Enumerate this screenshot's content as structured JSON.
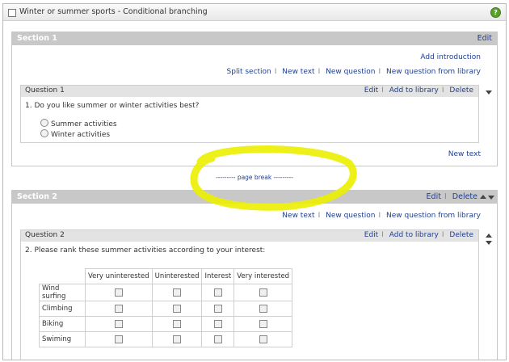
{
  "window": {
    "title": "Winter or summer sports - Conditional branching",
    "help_icon": "?"
  },
  "section1": {
    "title": "Section 1",
    "edit_label": "Edit",
    "add_intro": "Add introduction",
    "links": [
      "Split section",
      "New text",
      "New question",
      "New question from library"
    ],
    "question": {
      "title": "Question 1",
      "actions": [
        "Edit",
        "Add to library",
        "Delete"
      ],
      "text": "1.  Do you like summer or winter activities best?",
      "options": [
        "Summer activities",
        "Winter activities"
      ]
    },
    "new_text": "New text"
  },
  "page_break": "--------- page break ---------",
  "highlight_color": "#ecf000",
  "section2": {
    "title": "Section 2",
    "actions": [
      "Edit",
      "Delete"
    ],
    "links": [
      "New text",
      "New question",
      "New question from library"
    ],
    "question": {
      "title": "Question 2",
      "actions": [
        "Edit",
        "Add to library",
        "Delete"
      ],
      "text": "2.  Please rank these summer activities according to your interest:",
      "columns": [
        "Very uninterested",
        "Uninterested",
        "Interest",
        "Very interested"
      ],
      "rows": [
        "Wind surfing",
        "Climbing",
        "Biking",
        "Swiming"
      ]
    }
  }
}
